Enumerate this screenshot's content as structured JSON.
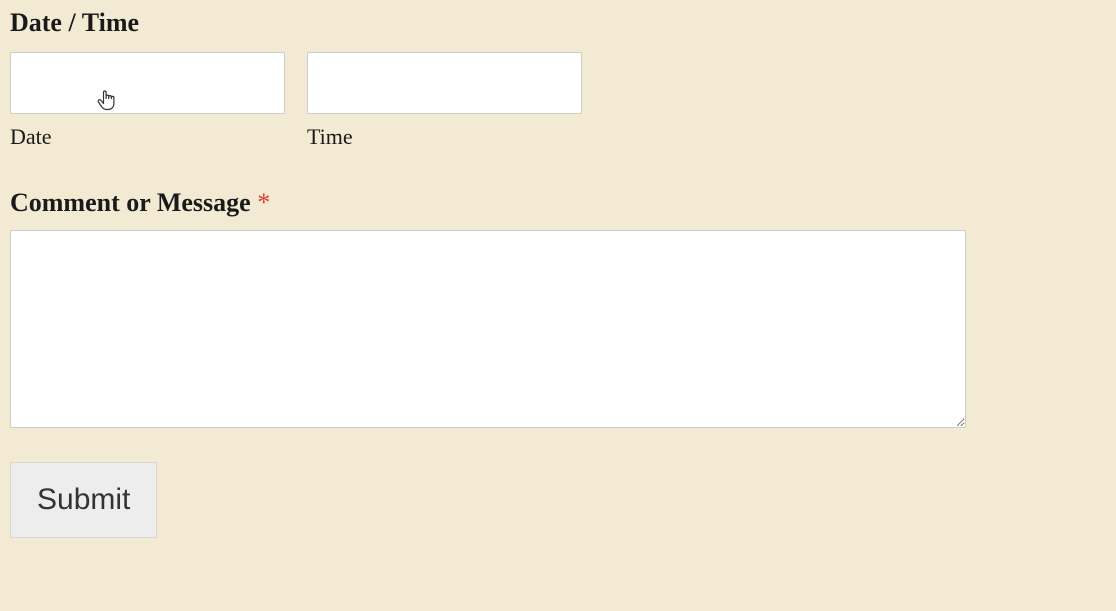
{
  "datetime": {
    "heading": "Date / Time",
    "date_label": "Date",
    "time_label": "Time",
    "date_value": "",
    "time_value": ""
  },
  "comment": {
    "heading": "Comment or Message ",
    "required_mark": "*",
    "value": ""
  },
  "submit": {
    "label": "Submit"
  }
}
